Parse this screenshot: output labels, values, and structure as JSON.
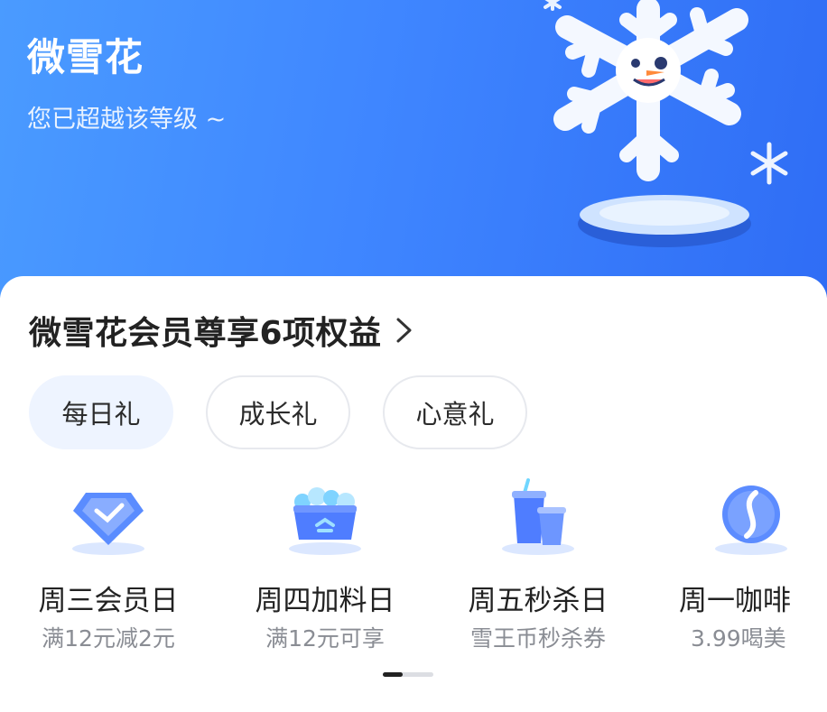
{
  "hero": {
    "level_name": "微雪花",
    "status_text": "您已超越该等级 ~",
    "mascot_icon": "snowflake-mascot-icon"
  },
  "benefits": {
    "title": "微雪花会员尊享6项权益",
    "arrow_icon": "chevron-right-icon"
  },
  "tabs": [
    {
      "label": "每日礼",
      "active": true
    },
    {
      "label": "成长礼",
      "active": false
    },
    {
      "label": "心意礼",
      "active": false
    }
  ],
  "items": [
    {
      "title": "周三会员日",
      "subtitle": "满12元减2元",
      "icon": "diamond-badge-icon"
    },
    {
      "title": "周四加料日",
      "subtitle": "满12元可享",
      "icon": "topping-box-icon"
    },
    {
      "title": "周五秒杀日",
      "subtitle": "雪王币秒杀券",
      "icon": "coffee-cups-icon"
    },
    {
      "title": "周一咖啡",
      "subtitle": "3.99喝美",
      "icon": "coffee-bean-icon"
    }
  ],
  "pagination": {
    "pages": 2,
    "current": 1
  },
  "colors": {
    "hero_gradient_start": "#4a9bff",
    "hero_gradient_end": "#2f6df5",
    "active_tab_bg": "#eef4ff",
    "icon_blue": "#4f87ff"
  }
}
